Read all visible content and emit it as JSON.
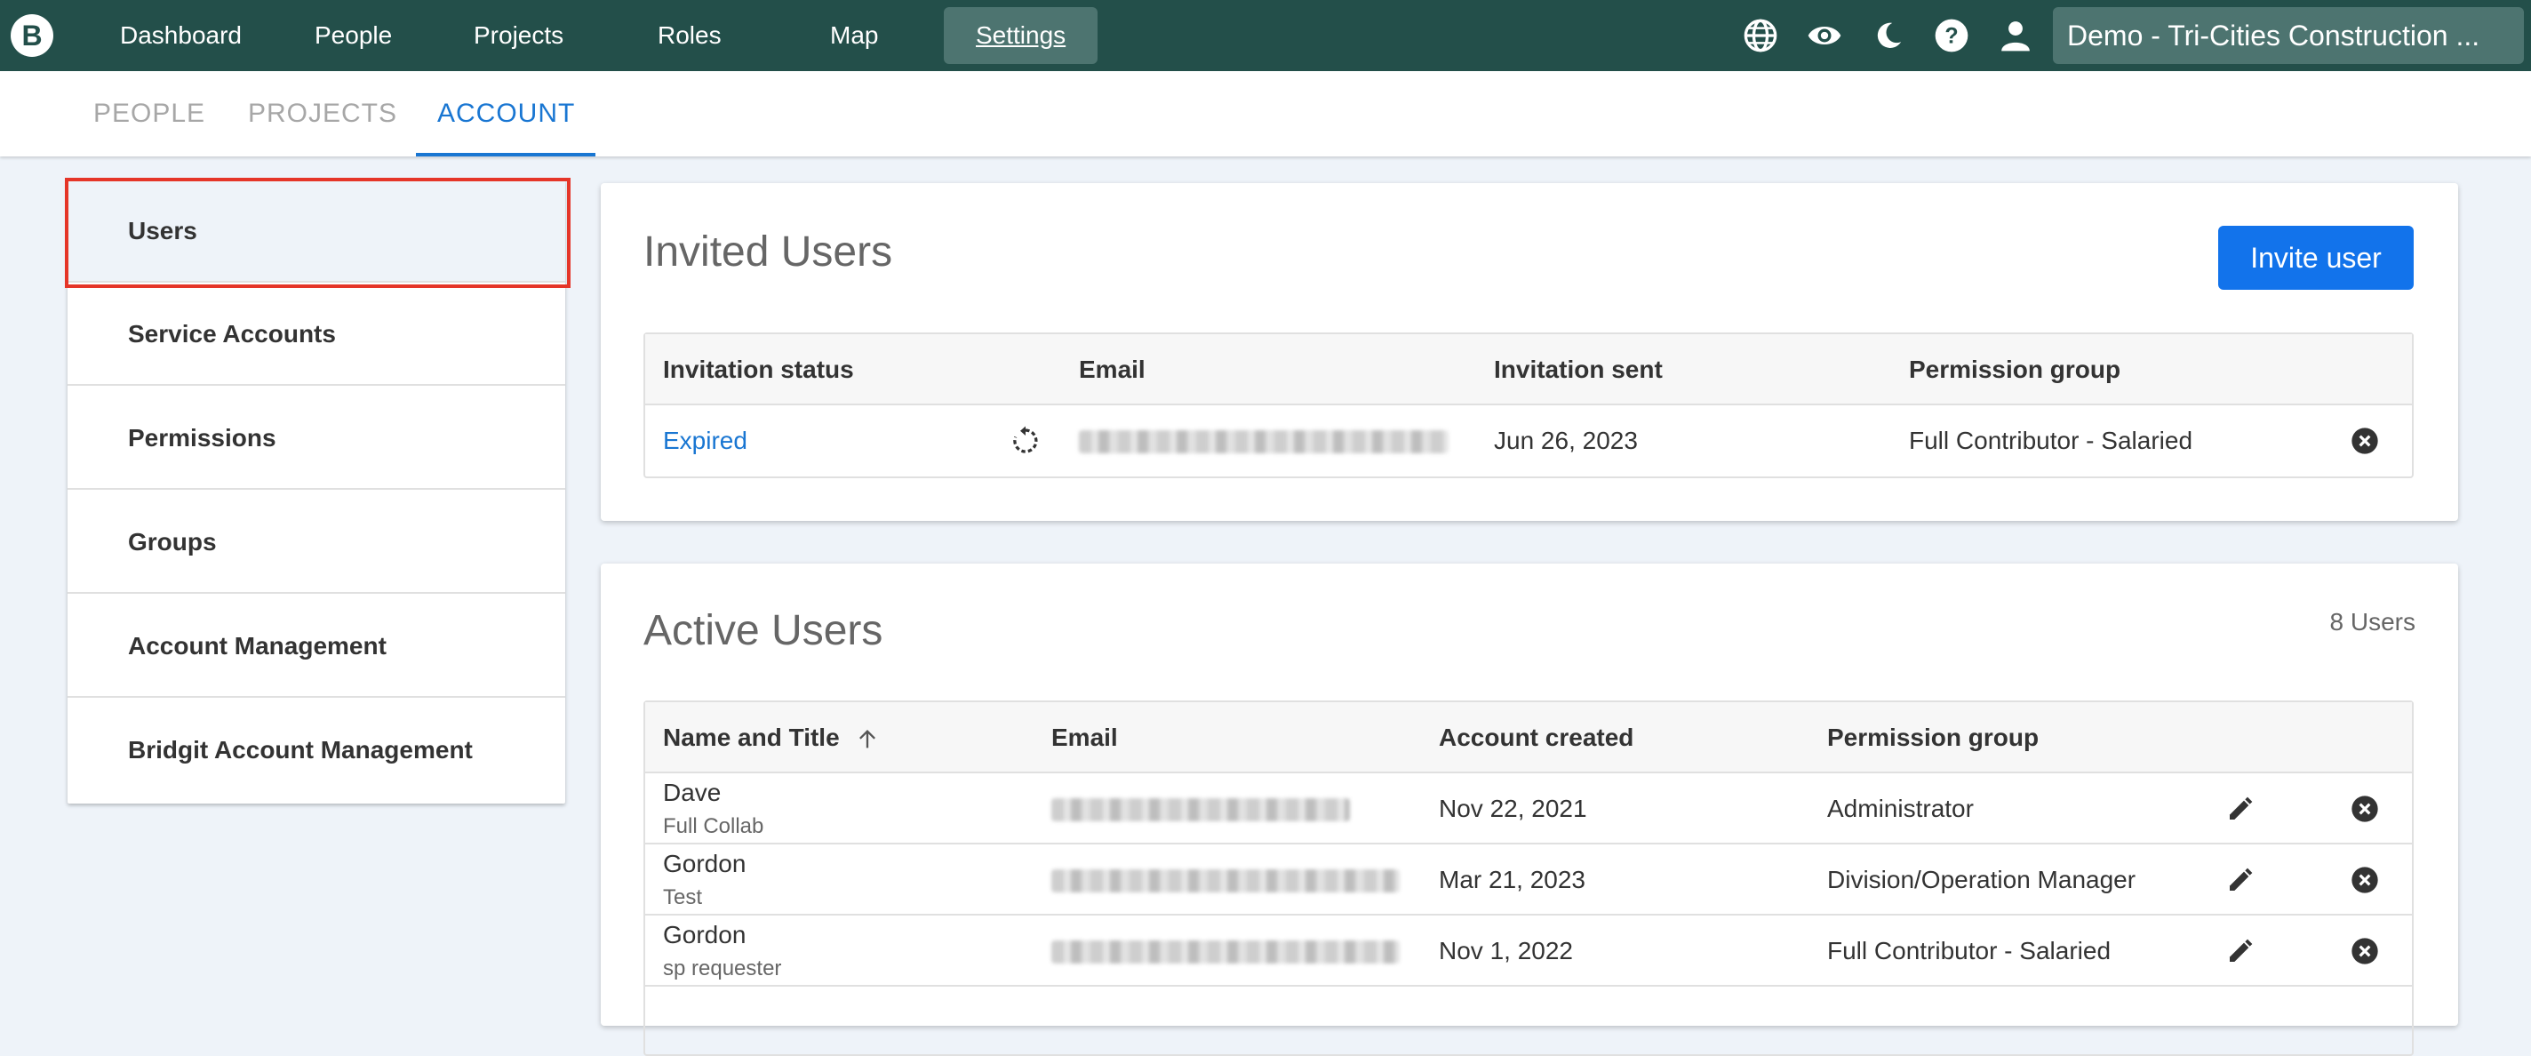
{
  "nav": {
    "items": [
      {
        "label": "Dashboard"
      },
      {
        "label": "People"
      },
      {
        "label": "Projects"
      },
      {
        "label": "Roles"
      },
      {
        "label": "Map"
      },
      {
        "label": "Settings"
      }
    ],
    "active": "Settings",
    "org_name": "Demo - Tri-Cities Construction ...",
    "icons": [
      "globe-icon",
      "eye-icon",
      "moon-icon",
      "help-icon",
      "user-icon"
    ]
  },
  "subtabs": {
    "items": [
      {
        "label": "PEOPLE"
      },
      {
        "label": "PROJECTS"
      },
      {
        "label": "ACCOUNT"
      }
    ],
    "active": "ACCOUNT"
  },
  "sidebar": {
    "items": [
      {
        "label": "Users"
      },
      {
        "label": "Service Accounts"
      },
      {
        "label": "Permissions"
      },
      {
        "label": "Groups"
      },
      {
        "label": "Account Management"
      },
      {
        "label": "Bridgit Account Management"
      }
    ],
    "selected": "Users"
  },
  "invited": {
    "title": "Invited Users",
    "invite_button": "Invite user",
    "columns": [
      "Invitation status",
      "Email",
      "Invitation sent",
      "Permission group"
    ],
    "rows": [
      {
        "status": "Expired",
        "email_redacted": true,
        "sent": "Jun 26, 2023",
        "group": "Full Contributor - Salaried"
      }
    ]
  },
  "active": {
    "title": "Active Users",
    "count": "8 Users",
    "columns": [
      "Name and Title",
      "Email",
      "Account created",
      "Permission group"
    ],
    "sort": "ascending",
    "rows": [
      {
        "name": "Dave",
        "title": "Full Collab",
        "email_redacted": true,
        "created": "Nov 22, 2021",
        "group": "Administrator"
      },
      {
        "name": "Gordon",
        "title": "Test",
        "email_redacted": true,
        "created": "Mar 21, 2023",
        "group": "Division/Operation Manager"
      },
      {
        "name": "Gordon",
        "title": "sp requester",
        "email_redacted": true,
        "created": "Nov 1, 2022",
        "group": "Full Contributor - Salaried"
      }
    ]
  },
  "colors": {
    "topbar": "#234f4a",
    "accent": "#1976d2",
    "button": "#1273eb",
    "highlight": "#e53528"
  }
}
